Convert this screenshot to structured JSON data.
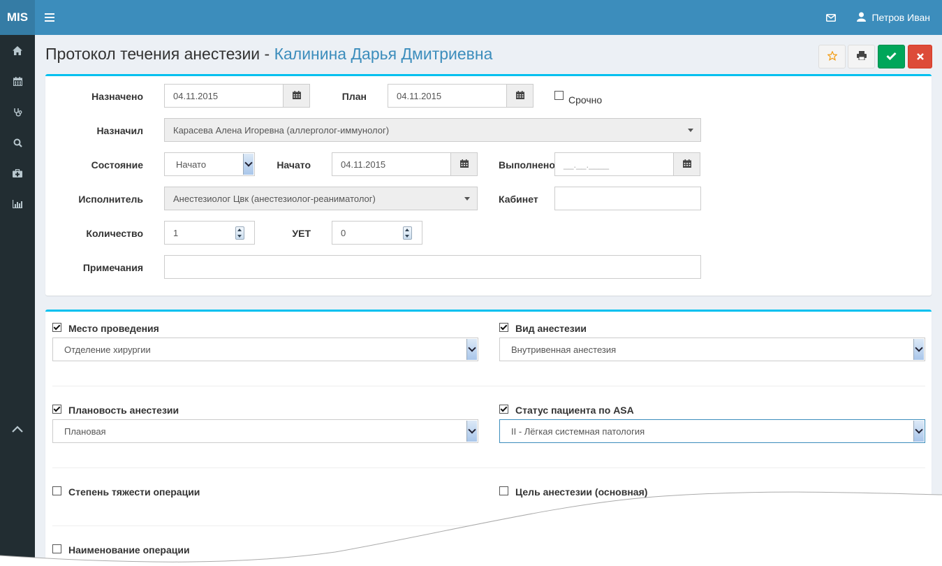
{
  "app": {
    "brand": "MIS",
    "user_name": "Петров Иван"
  },
  "colors": {
    "header": "#3c8dbc",
    "sidebar": "#222d32",
    "accent": "#00c0ef",
    "success": "#00a65a",
    "danger": "#dd4b39"
  },
  "sidebar": {
    "items": [
      {
        "icon": "home-icon"
      },
      {
        "icon": "calendar-icon"
      },
      {
        "icon": "stethoscope-icon"
      },
      {
        "icon": "search-icon"
      },
      {
        "icon": "medkit-icon"
      },
      {
        "icon": "bar-chart-icon"
      }
    ],
    "collapse_icon": "chevron-up-icon"
  },
  "header": {
    "title": "Протокол течения анестезии - ",
    "patient": "Калинина Дарья Дмитриевна",
    "buttons": [
      "star-icon",
      "print-icon",
      "check-icon",
      "close-icon"
    ]
  },
  "form": {
    "assigned_label": "Назначено",
    "assigned_date": "04.11.2015",
    "plan_label": "План",
    "plan_date": "04.11.2015",
    "urgent_label": "Срочно",
    "assigned_by_label": "Назначил",
    "assigned_by_value": "Карасева Алена Игоревна (аллерголог-иммунолог)",
    "state_label": "Состояние",
    "state_value": "Начато",
    "started_label": "Начато",
    "started_date": "04.11.2015",
    "done_label": "Выполнено",
    "done_placeholder": "__.__.____",
    "performer_label": "Исполнитель",
    "performer_value": "Анестезиолог Цвк (анестезиолог-реаниматолог)",
    "cabinet_label": "Кабинет",
    "cabinet_value": "",
    "quantity_label": "Количество",
    "quantity_value": "1",
    "uet_label": "УЕТ",
    "uet_value": "0",
    "notes_label": "Примечания",
    "notes_value": ""
  },
  "details": {
    "place_label": "Место проведения",
    "place_value": "Отделение хирургии",
    "type_label": "Вид анестезии",
    "type_value": "Внутривенная анестезия",
    "planning_label": "Плановость анестезии",
    "planning_value": "Плановая",
    "asa_label": "Статус пациента по ASA",
    "asa_value": "II - Лёгкая системная патология",
    "severity_label": "Степень тяжести операции",
    "goal_label": "Цель анестезии (основная)",
    "operation_label": "Наименование операции"
  }
}
